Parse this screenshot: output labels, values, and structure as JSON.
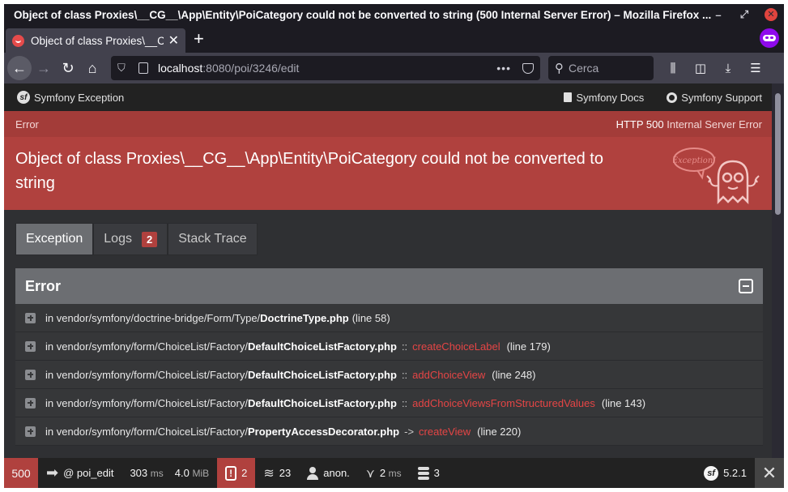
{
  "window": {
    "title": "Object of class Proxies\\__CG__\\App\\Entity\\PoiCategory could not be converted to string (500 Internal Server Error) – Mozilla Firefox ..."
  },
  "browser": {
    "tab_title": "Object of class Proxies\\__C",
    "url_host": "localhost",
    "url_rest": ":8080/poi/3246/edit",
    "search_placeholder": "Cerca"
  },
  "sf_header": {
    "brand": "Symfony Exception",
    "docs": "Symfony Docs",
    "support": "Symfony Support"
  },
  "exception": {
    "label": "Error",
    "status_code": "HTTP 500",
    "status_text": "Internal Server Error",
    "message": "Object of class Proxies\\__CG__\\App\\Entity\\PoiCategory could not be converted to string",
    "ghost_text": "Exception!"
  },
  "content_tabs": [
    {
      "label": "Exception"
    },
    {
      "label": "Logs",
      "badge": "2"
    },
    {
      "label": "Stack Trace"
    }
  ],
  "trace": {
    "title": "Error",
    "rows": [
      {
        "prefix": "in vendor/symfony/doctrine-bridge/Form/Type/",
        "file": "DoctrineType.php",
        "sep": "",
        "fn": "",
        "line": "(line 58)"
      },
      {
        "prefix": "in vendor/symfony/form/ChoiceList/Factory/",
        "file": "DefaultChoiceListFactory.php",
        "sep": "::",
        "fn": "createChoiceLabel",
        "line": "(line 179)"
      },
      {
        "prefix": "in vendor/symfony/form/ChoiceList/Factory/",
        "file": "DefaultChoiceListFactory.php",
        "sep": "::",
        "fn": "addChoiceView",
        "line": "(line 248)"
      },
      {
        "prefix": "in vendor/symfony/form/ChoiceList/Factory/",
        "file": "DefaultChoiceListFactory.php",
        "sep": "::",
        "fn": "addChoiceViewsFromStructuredValues",
        "line": "(line 143)"
      },
      {
        "prefix": "in vendor/symfony/form/ChoiceList/Factory/",
        "file": "PropertyAccessDecorator.php",
        "sep": "->",
        "fn": "createView",
        "line": "(line 220)"
      }
    ]
  },
  "toolbar": {
    "status": "500",
    "route": "@ poi_edit",
    "time": "303",
    "time_unit": "ms",
    "memory": "4.0",
    "memory_unit": "MiB",
    "exceptions": "2",
    "forms": "23",
    "user": "anon.",
    "twig_time": "2",
    "twig_unit": "ms",
    "db_queries": "3",
    "version": "5.2.1"
  },
  "colors": {
    "error_red": "#b0413e",
    "function_red": "#e54545",
    "private_purple": "#8f0aec"
  }
}
